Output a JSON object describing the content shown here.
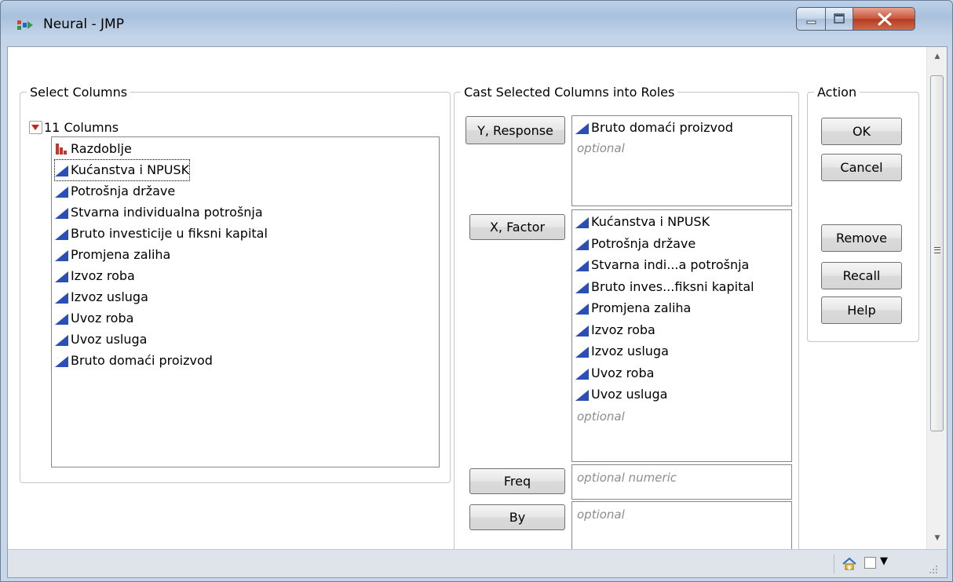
{
  "window": {
    "title": "Neural - JMP"
  },
  "select_columns": {
    "legend": "Select Columns",
    "count_label": "11 Columns",
    "items": [
      {
        "label": "Razdoblje",
        "type": "ordinal"
      },
      {
        "label": "Kućanstva i NPUSK",
        "type": "continuous"
      },
      {
        "label": "Potrošnja države",
        "type": "continuous"
      },
      {
        "label": "Stvarna individualna potrošnja",
        "type": "continuous"
      },
      {
        "label": "Bruto investicije u fiksni kapital",
        "type": "continuous"
      },
      {
        "label": "Promjena zaliha",
        "type": "continuous"
      },
      {
        "label": "Izvoz roba",
        "type": "continuous"
      },
      {
        "label": "Izvoz usluga",
        "type": "continuous"
      },
      {
        "label": "Uvoz roba",
        "type": "continuous"
      },
      {
        "label": "Uvoz usluga",
        "type": "continuous"
      },
      {
        "label": "Bruto domaći proizvod",
        "type": "continuous"
      }
    ]
  },
  "cast": {
    "legend": "Cast Selected Columns into Roles",
    "y": {
      "button": "Y, Response",
      "items": [
        "Bruto domaći proizvod"
      ],
      "placeholder": "optional"
    },
    "x": {
      "button": "X, Factor",
      "items": [
        "Kućanstva i NPUSK",
        "Potrošnja države",
        "Stvarna indi...a potrošnja",
        "Bruto inves...fiksni kapital",
        "Promjena zaliha",
        "Izvoz roba",
        "Izvoz usluga",
        "Uvoz roba",
        "Uvoz usluga"
      ],
      "placeholder": "optional"
    },
    "freq": {
      "button": "Freq",
      "placeholder": "optional numeric"
    },
    "by": {
      "button": "By",
      "placeholder": "optional"
    }
  },
  "action": {
    "legend": "Action",
    "ok": "OK",
    "cancel": "Cancel",
    "remove": "Remove",
    "recall": "Recall",
    "help": "Help"
  },
  "colors": {
    "continuous_icon": "#2c4fb6",
    "ordinal_icon": "#c8342b",
    "close_button": "#c9533a"
  }
}
